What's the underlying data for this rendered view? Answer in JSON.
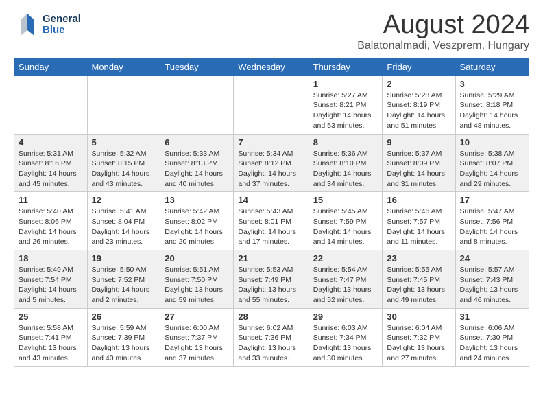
{
  "header": {
    "logo_general": "General",
    "logo_blue": "Blue",
    "month_year": "August 2024",
    "location": "Balatonalmadi, Veszprem, Hungary"
  },
  "days_of_week": [
    "Sunday",
    "Monday",
    "Tuesday",
    "Wednesday",
    "Thursday",
    "Friday",
    "Saturday"
  ],
  "weeks": [
    {
      "days": [
        {
          "number": "",
          "info": ""
        },
        {
          "number": "",
          "info": ""
        },
        {
          "number": "",
          "info": ""
        },
        {
          "number": "",
          "info": ""
        },
        {
          "number": "1",
          "info": "Sunrise: 5:27 AM\nSunset: 8:21 PM\nDaylight: 14 hours\nand 53 minutes."
        },
        {
          "number": "2",
          "info": "Sunrise: 5:28 AM\nSunset: 8:19 PM\nDaylight: 14 hours\nand 51 minutes."
        },
        {
          "number": "3",
          "info": "Sunrise: 5:29 AM\nSunset: 8:18 PM\nDaylight: 14 hours\nand 48 minutes."
        }
      ]
    },
    {
      "days": [
        {
          "number": "4",
          "info": "Sunrise: 5:31 AM\nSunset: 8:16 PM\nDaylight: 14 hours\nand 45 minutes."
        },
        {
          "number": "5",
          "info": "Sunrise: 5:32 AM\nSunset: 8:15 PM\nDaylight: 14 hours\nand 43 minutes."
        },
        {
          "number": "6",
          "info": "Sunrise: 5:33 AM\nSunset: 8:13 PM\nDaylight: 14 hours\nand 40 minutes."
        },
        {
          "number": "7",
          "info": "Sunrise: 5:34 AM\nSunset: 8:12 PM\nDaylight: 14 hours\nand 37 minutes."
        },
        {
          "number": "8",
          "info": "Sunrise: 5:36 AM\nSunset: 8:10 PM\nDaylight: 14 hours\nand 34 minutes."
        },
        {
          "number": "9",
          "info": "Sunrise: 5:37 AM\nSunset: 8:09 PM\nDaylight: 14 hours\nand 31 minutes."
        },
        {
          "number": "10",
          "info": "Sunrise: 5:38 AM\nSunset: 8:07 PM\nDaylight: 14 hours\nand 29 minutes."
        }
      ]
    },
    {
      "days": [
        {
          "number": "11",
          "info": "Sunrise: 5:40 AM\nSunset: 8:06 PM\nDaylight: 14 hours\nand 26 minutes."
        },
        {
          "number": "12",
          "info": "Sunrise: 5:41 AM\nSunset: 8:04 PM\nDaylight: 14 hours\nand 23 minutes."
        },
        {
          "number": "13",
          "info": "Sunrise: 5:42 AM\nSunset: 8:02 PM\nDaylight: 14 hours\nand 20 minutes."
        },
        {
          "number": "14",
          "info": "Sunrise: 5:43 AM\nSunset: 8:01 PM\nDaylight: 14 hours\nand 17 minutes."
        },
        {
          "number": "15",
          "info": "Sunrise: 5:45 AM\nSunset: 7:59 PM\nDaylight: 14 hours\nand 14 minutes."
        },
        {
          "number": "16",
          "info": "Sunrise: 5:46 AM\nSunset: 7:57 PM\nDaylight: 14 hours\nand 11 minutes."
        },
        {
          "number": "17",
          "info": "Sunrise: 5:47 AM\nSunset: 7:56 PM\nDaylight: 14 hours\nand 8 minutes."
        }
      ]
    },
    {
      "days": [
        {
          "number": "18",
          "info": "Sunrise: 5:49 AM\nSunset: 7:54 PM\nDaylight: 14 hours\nand 5 minutes."
        },
        {
          "number": "19",
          "info": "Sunrise: 5:50 AM\nSunset: 7:52 PM\nDaylight: 14 hours\nand 2 minutes."
        },
        {
          "number": "20",
          "info": "Sunrise: 5:51 AM\nSunset: 7:50 PM\nDaylight: 13 hours\nand 59 minutes."
        },
        {
          "number": "21",
          "info": "Sunrise: 5:53 AM\nSunset: 7:49 PM\nDaylight: 13 hours\nand 55 minutes."
        },
        {
          "number": "22",
          "info": "Sunrise: 5:54 AM\nSunset: 7:47 PM\nDaylight: 13 hours\nand 52 minutes."
        },
        {
          "number": "23",
          "info": "Sunrise: 5:55 AM\nSunset: 7:45 PM\nDaylight: 13 hours\nand 49 minutes."
        },
        {
          "number": "24",
          "info": "Sunrise: 5:57 AM\nSunset: 7:43 PM\nDaylight: 13 hours\nand 46 minutes."
        }
      ]
    },
    {
      "days": [
        {
          "number": "25",
          "info": "Sunrise: 5:58 AM\nSunset: 7:41 PM\nDaylight: 13 hours\nand 43 minutes."
        },
        {
          "number": "26",
          "info": "Sunrise: 5:59 AM\nSunset: 7:39 PM\nDaylight: 13 hours\nand 40 minutes."
        },
        {
          "number": "27",
          "info": "Sunrise: 6:00 AM\nSunset: 7:37 PM\nDaylight: 13 hours\nand 37 minutes."
        },
        {
          "number": "28",
          "info": "Sunrise: 6:02 AM\nSunset: 7:36 PM\nDaylight: 13 hours\nand 33 minutes."
        },
        {
          "number": "29",
          "info": "Sunrise: 6:03 AM\nSunset: 7:34 PM\nDaylight: 13 hours\nand 30 minutes."
        },
        {
          "number": "30",
          "info": "Sunrise: 6:04 AM\nSunset: 7:32 PM\nDaylight: 13 hours\nand 27 minutes."
        },
        {
          "number": "31",
          "info": "Sunrise: 6:06 AM\nSunset: 7:30 PM\nDaylight: 13 hours\nand 24 minutes."
        }
      ]
    }
  ]
}
